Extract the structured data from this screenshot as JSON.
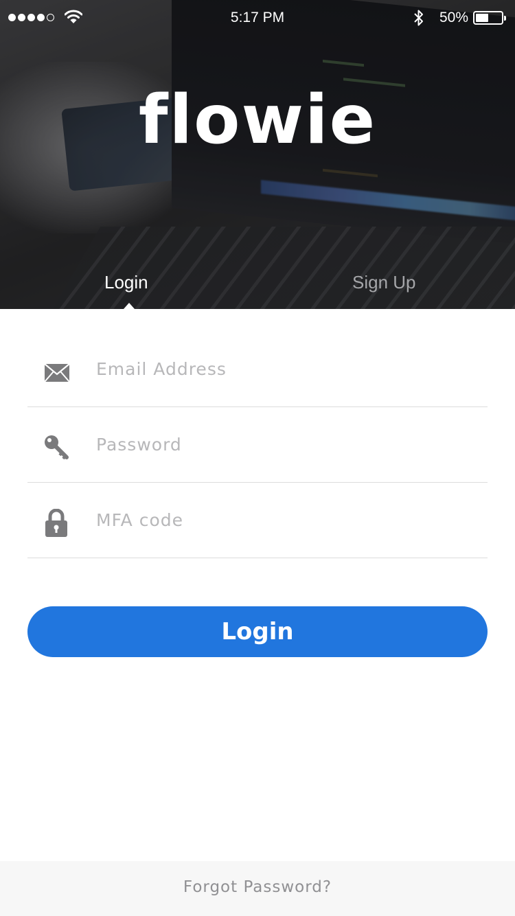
{
  "status_bar": {
    "time": "5:17 PM",
    "battery_percent": "50%",
    "battery_level": 0.5,
    "signal_bars": 4,
    "signal_total": 5,
    "icons": [
      "wifi-icon",
      "bluetooth-icon",
      "battery-icon"
    ]
  },
  "brand": {
    "logo_text": "flowie"
  },
  "tabs": [
    {
      "label": "Login",
      "active": true
    },
    {
      "label": "Sign Up",
      "active": false
    }
  ],
  "form": {
    "email": {
      "placeholder": "Email Address",
      "value": "",
      "icon": "envelope-icon"
    },
    "password": {
      "placeholder": "Password",
      "value": "",
      "icon": "key-icon"
    },
    "mfa": {
      "placeholder": "MFA code",
      "value": "",
      "icon": "lock-icon"
    },
    "submit_label": "Login"
  },
  "footer": {
    "forgot_label": "Forgot Password?"
  },
  "colors": {
    "accent": "#2176de",
    "placeholder": "#b7b7b9",
    "divider": "#dcdcdc",
    "icon": "#7a7a7c",
    "footer_bg": "#f7f7f7",
    "inactive_tab": "#a5a6a9"
  }
}
